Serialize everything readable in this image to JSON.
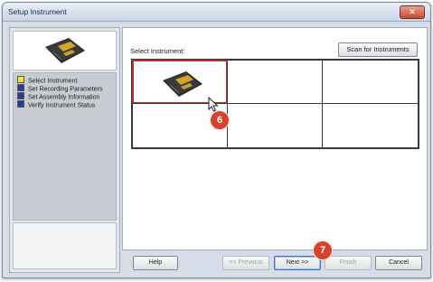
{
  "window": {
    "title": "Setup Instrument",
    "close_glyph": "✕"
  },
  "steps": [
    {
      "label": "Select Instrument",
      "color": "#f0e040"
    },
    {
      "label": "Set Recording Parameters",
      "color": "#2a3a9a"
    },
    {
      "label": "Set Assembly Information",
      "color": "#2a3a9a"
    },
    {
      "label": "Verify Instrument Status",
      "color": "#2a3a9a"
    }
  ],
  "main": {
    "select_label": "Select Instrument:",
    "scan_button": "Scan for Instruments",
    "selected_cell": 0
  },
  "callouts": {
    "cursor_badge": "6",
    "next_badge": "7"
  },
  "footer": {
    "help": "Help",
    "previous": "<< Previous",
    "next": "Next >>",
    "finish": "Finish",
    "cancel": "Cancel"
  },
  "colors": {
    "accent_badge": "#d9412a",
    "selection_border": "#b5302a"
  }
}
